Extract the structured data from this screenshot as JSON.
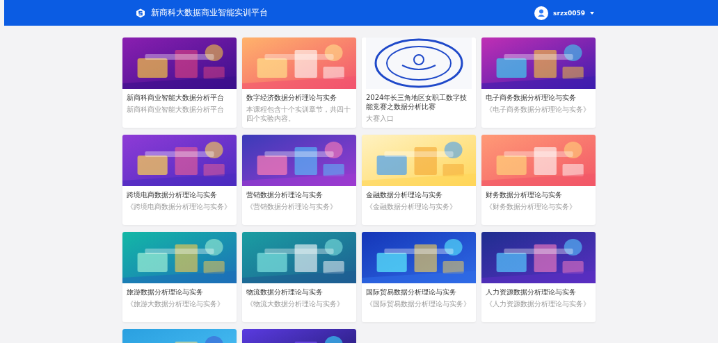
{
  "header": {
    "title": "新商科大数据商业智能实训平台",
    "user": "srzx0059"
  },
  "courses": [
    {
      "image": {
        "kind": "picture"
      },
      "title": "新商科商业智能大数据分析平台",
      "subtitle": "新商科商业智能大数据分析平台"
    },
    {
      "image": {
        "kind": "picture"
      },
      "title": "数字经济数据分析理论与实务",
      "subtitle": "本课程包含十个实训章节，共四十四个实验内容。"
    },
    {
      "image": {
        "kind": "picture"
      },
      "title": "2024年长三角地区女职工数字技能竞赛之数据分析比赛",
      "subtitle": "大赛入口"
    },
    {
      "image": {
        "kind": "picture"
      },
      "title": "电子商务数据分析理论与实务",
      "subtitle": "《电子商务数据分析理论与实务》"
    },
    {
      "image": {
        "kind": "picture"
      },
      "title": "跨境电商数据分析理论与实务",
      "subtitle": "《跨境电商数据分析理论与实务》"
    },
    {
      "image": {
        "kind": "picture"
      },
      "title": "营销数据分析理论与实务",
      "subtitle": "《营销数据分析理论与实务》"
    },
    {
      "image": {
        "kind": "picture"
      },
      "title": "金融数据分析理论与实务",
      "subtitle": "《金融数据分析理论与实务》"
    },
    {
      "image": {
        "kind": "picture"
      },
      "title": "财务数据分析理论与实务",
      "subtitle": "《财务数据分析理论与实务》"
    },
    {
      "image": {
        "kind": "picture"
      },
      "title": "旅游数据分析理论与实务",
      "subtitle": "《旅游大数据分析理论与实务》"
    },
    {
      "image": {
        "kind": "picture"
      },
      "title": "物流数据分析理论与实务",
      "subtitle": "《物流大数据分析理论与实务》"
    },
    {
      "image": {
        "kind": "picture"
      },
      "title": "国际贸易数据分析理论与实务",
      "subtitle": "《国际贸易数据分析理论与实务》"
    },
    {
      "image": {
        "kind": "picture"
      },
      "title": "人力资源数据分析理论与实务",
      "subtitle": "《人力资源数据分析理论与实务》"
    },
    {
      "image": {
        "kind": "picture"
      }
    },
    {
      "image": {
        "kind": "picture"
      }
    }
  ]
}
